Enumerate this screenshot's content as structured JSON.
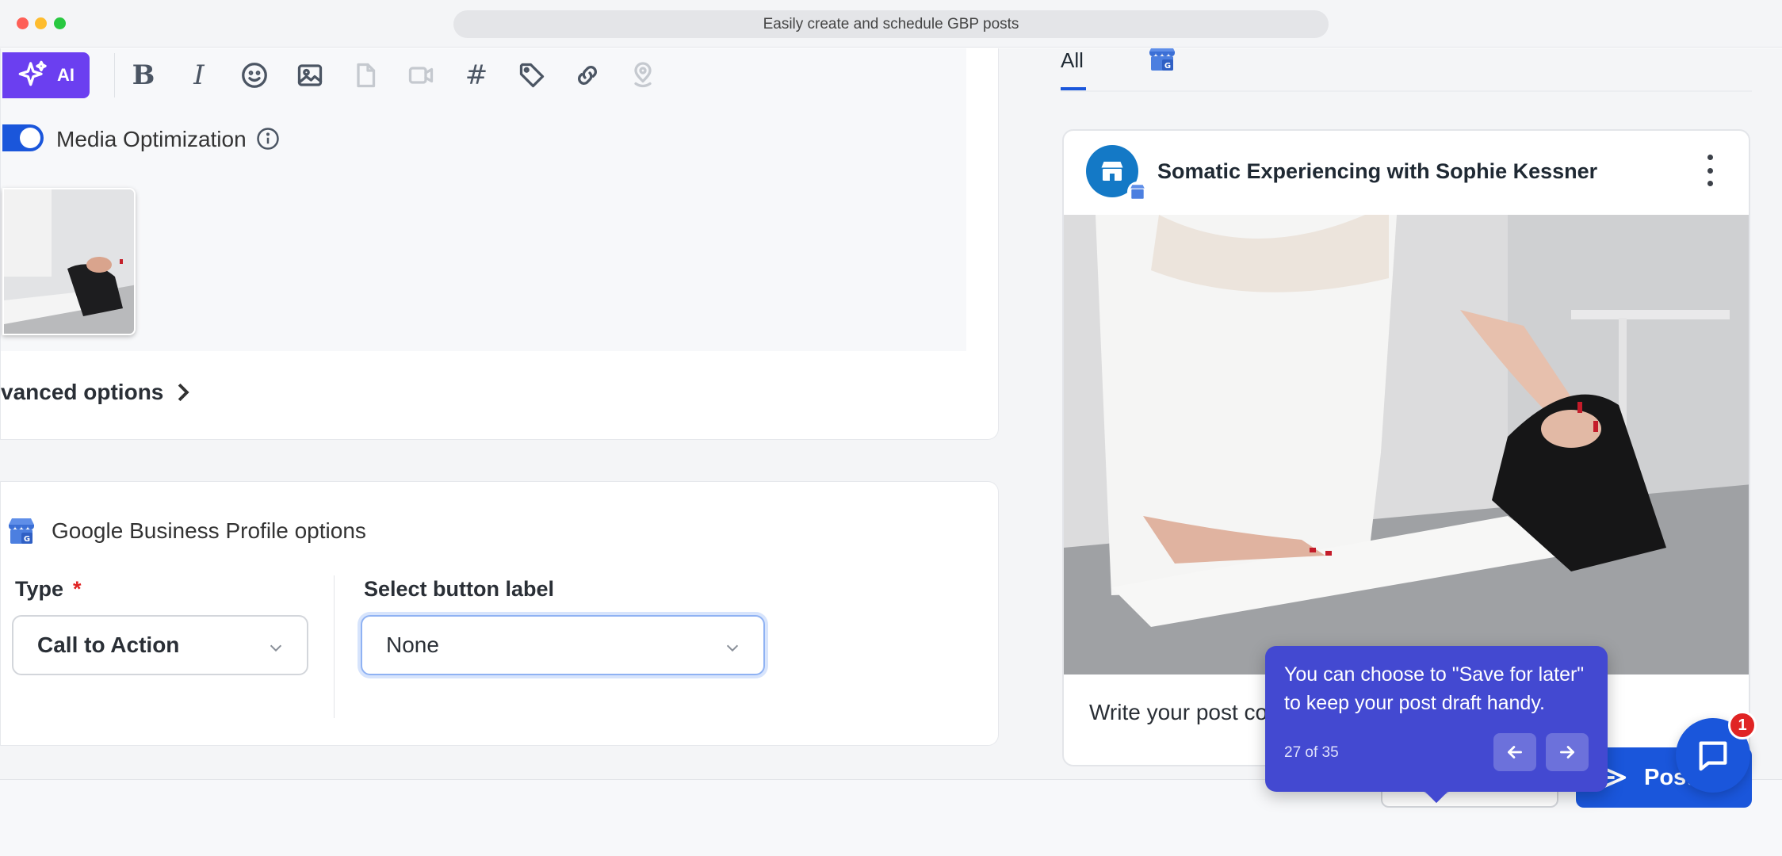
{
  "window": {
    "title": "Easily create and schedule GBP posts"
  },
  "editor": {
    "ai_label": "AI",
    "bold_glyph": "B",
    "italic_glyph": "I",
    "hashtag_glyph": "#",
    "media_optimization_label": "Media Optimization",
    "media_optimization_enabled": true,
    "advanced_options_label": "vanced options"
  },
  "gbp_options": {
    "title": "Google Business Profile options",
    "type_label": "Type",
    "required_mark": "*",
    "type_value": "Call to Action",
    "button_label_title": "Select button label",
    "button_label_value": "None"
  },
  "preview": {
    "tab_all": "All",
    "profile_name": "Somatic Experiencing with Sophie Kessner",
    "post_placeholder": "Write your post cop"
  },
  "tooltip": {
    "text": "You can choose to \"Save for later\" to keep your post draft handy.",
    "step": "27 of 35"
  },
  "actions": {
    "save_for_later": "Sa  for later",
    "post": "Post"
  },
  "chat": {
    "badge_count": "1"
  },
  "colors": {
    "accent": "#1a56db",
    "ai_purple": "#6b3ff0",
    "tooltip_bg": "#4349d1",
    "badge_red": "#e02424"
  }
}
